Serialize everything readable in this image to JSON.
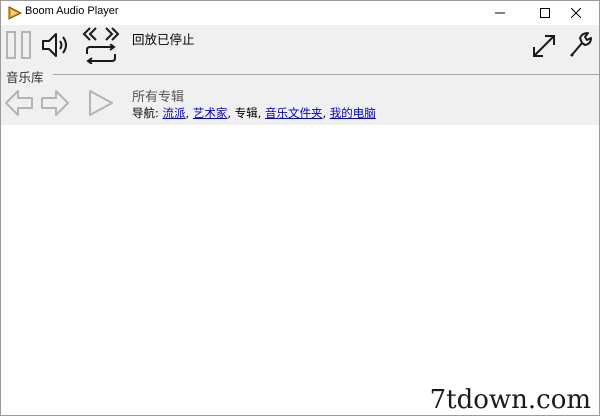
{
  "window": {
    "title": "Boom Audio Player",
    "controls": [
      "minimize",
      "maximize",
      "close"
    ]
  },
  "toolbar": {
    "icons": [
      "pause-icon",
      "volume-icon",
      "previous-next-icon",
      "repeat-icon",
      "fullscreen-icon",
      "settings-wrench-icon"
    ],
    "status": "回放已停止"
  },
  "library": {
    "section_label": "音乐库",
    "nav_icons": [
      "back-arrow-icon",
      "forward-arrow-icon",
      "play-icon"
    ],
    "album_title": "所有专辑",
    "breadcrumb": {
      "prefix": "导航:",
      "items": [
        {
          "label": "流派",
          "link": true
        },
        {
          "label": "艺术家",
          "link": true
        },
        {
          "label": "专辑",
          "link": false
        },
        {
          "label": "音乐文件夹",
          "link": true
        },
        {
          "label": "我的电脑",
          "link": true
        }
      ],
      "separator": ", "
    }
  },
  "watermark": "7tdown.com",
  "colors": {
    "panel": "#f0f0f0",
    "link": "#0000cc",
    "icon_dark": "#1a1a1a",
    "icon_light": "#b4b4b4"
  }
}
